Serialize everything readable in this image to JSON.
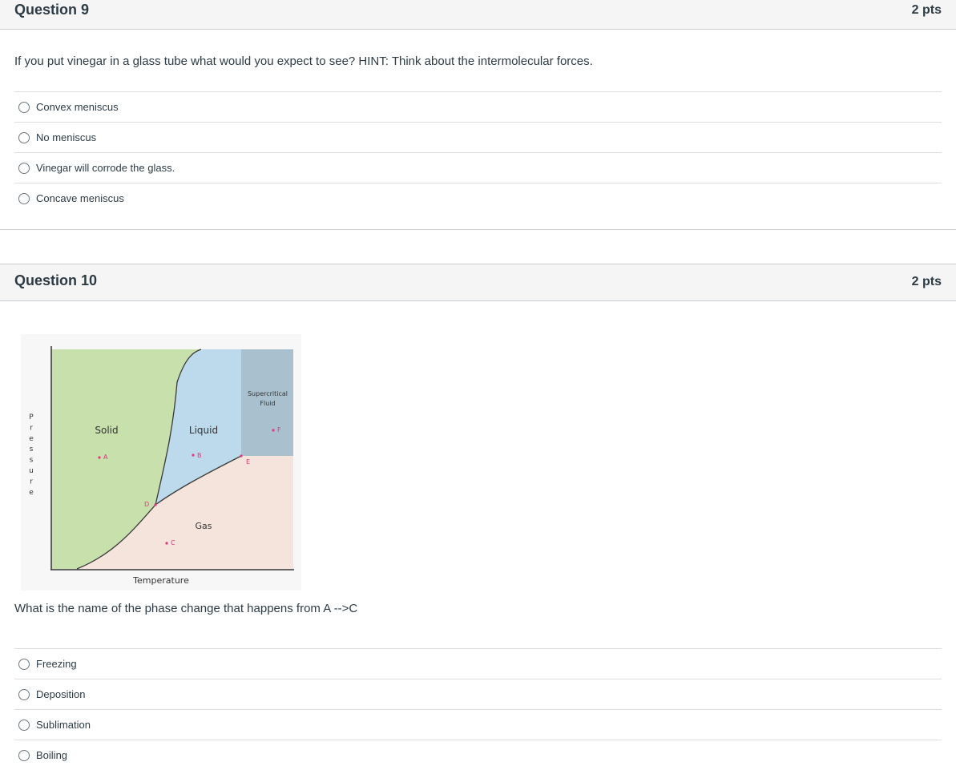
{
  "q9": {
    "title": "Question 9",
    "points": "2 pts",
    "prompt": "If you put vinegar in a glass tube what would you expect to see? HINT: Think about the intermolecular forces.",
    "answers": [
      {
        "label": "Convex meniscus"
      },
      {
        "label": "No meniscus"
      },
      {
        "label": "Vinegar will corrode the glass."
      },
      {
        "label": "Concave meniscus"
      }
    ]
  },
  "q10": {
    "title": "Question 10",
    "points": "2 pts",
    "prompt": "What is the name of the phase change that happens from A -->C",
    "figure": {
      "y_axis_label": "Pressure",
      "x_axis_label": "Temperature",
      "regions": {
        "solid": "Solid",
        "liquid": "Liquid",
        "gas": "Gas",
        "supercritical_line1": "Supercritical",
        "supercritical_line2": "Fluid"
      },
      "points": {
        "A": "A",
        "B": "B",
        "C": "C",
        "D": "D",
        "E": "E",
        "F": "F"
      },
      "colors": {
        "solid": "#c8e0ab",
        "liquid": "#bcdaec",
        "gas": "#f4e4dc",
        "supercritical": "#a9c0cf",
        "point": "#e2367f"
      }
    },
    "answers": [
      {
        "label": "Freezing"
      },
      {
        "label": "Deposition"
      },
      {
        "label": "Sublimation"
      },
      {
        "label": "Boiling"
      }
    ]
  }
}
